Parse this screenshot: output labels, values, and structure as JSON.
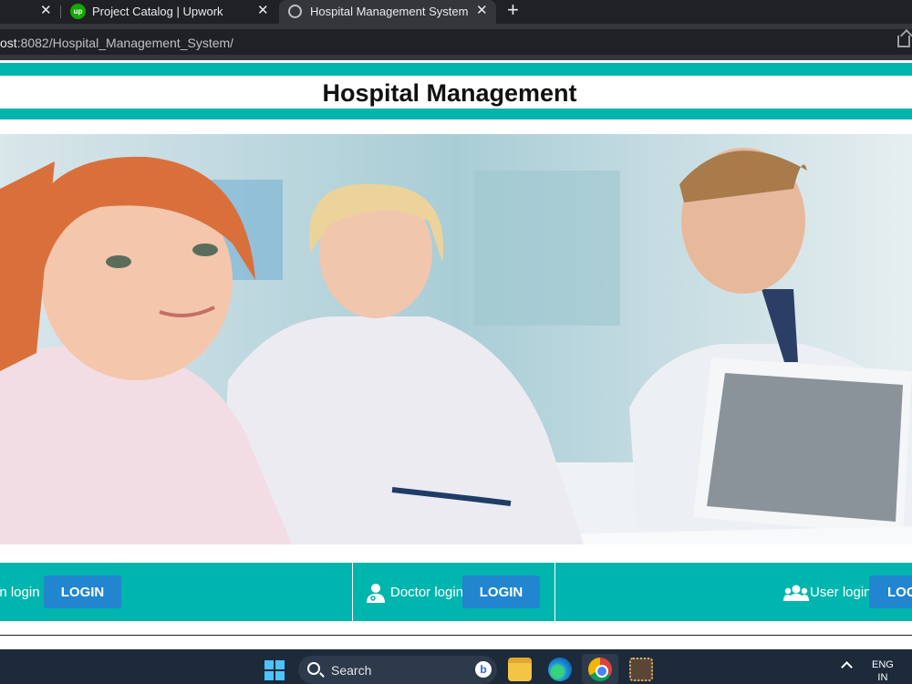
{
  "browser": {
    "tabs": [
      {
        "label": "",
        "active": false
      },
      {
        "label": "Project Catalog | Upwork",
        "favicon": "up",
        "active": false
      },
      {
        "label": "Hospital Management System",
        "active": true
      }
    ],
    "close_glyph": "✕",
    "new_tab_glyph": "+",
    "url_host": "ost",
    "url_rest": ":8082/Hospital_Management_System/"
  },
  "page": {
    "title": "Hospital Management",
    "logins": [
      {
        "label": "in login",
        "button": "LOGIN",
        "icon": "admin-icon"
      },
      {
        "label": "Doctor login",
        "button": "LOGIN",
        "icon": "doctor-icon"
      },
      {
        "label": "User login",
        "button": "LOG",
        "icon": "users-icon"
      }
    ]
  },
  "taskbar": {
    "search_placeholder": "Search",
    "bing_glyph": "b",
    "lang_line1": "ENG",
    "lang_line2": "IN"
  },
  "colors": {
    "teal": "#00b5ad",
    "button_blue": "#2185d0",
    "taskbar": "#1c2a3a"
  }
}
